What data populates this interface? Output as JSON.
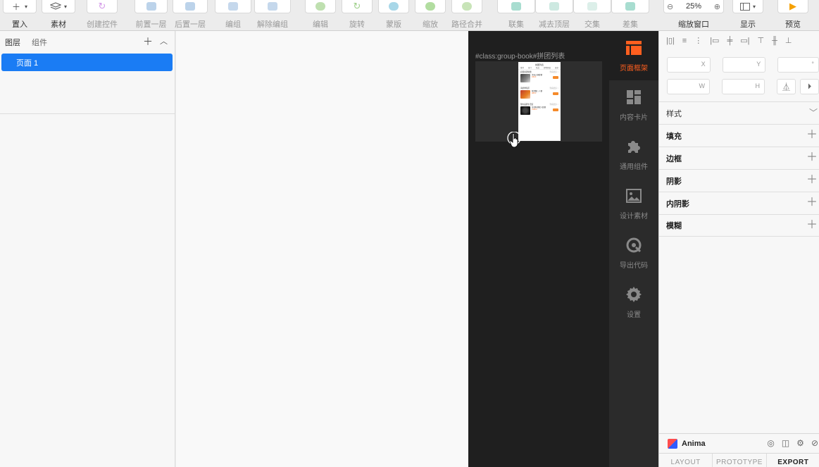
{
  "toolbar": {
    "insert": "置入",
    "assets": "素材",
    "create_symbol": "创建控件",
    "forward": "前置一层",
    "backward": "后置一层",
    "group": "编组",
    "ungroup": "解除编组",
    "edit": "编辑",
    "rotate": "旋转",
    "mask": "蒙版",
    "scale": "缩放",
    "flatten": "路径合并",
    "union": "联集",
    "subtract": "减去顶层",
    "intersect": "交集",
    "difference": "差集",
    "zoom_value": "25%",
    "zoom": "缩放窗口",
    "view": "显示",
    "preview": "预览"
  },
  "left_panel": {
    "tab_layers": "图层",
    "tab_components": "组件",
    "pages": [
      "页面 1"
    ]
  },
  "plugin": {
    "title": "#class:group-book#拼团列表",
    "phone": {
      "title": "拼团列表",
      "tabs": [
        "推荐",
        "热门",
        "新品",
        "即将开始",
        "更多"
      ],
      "sections": [
        {
          "title": "超值拼团特惠",
          "more": "查看更多 >",
          "item": "美味火锅套餐",
          "price": "¥49.9"
        },
        {
          "title": "海鲜季专区",
          "more": "查看更多 >",
          "item": "鲜虾蟹三人餐",
          "price": "¥88.0"
        },
        {
          "title": "限时品质生活馆",
          "more": "查看更多 >",
          "item": "日式料理双人套餐",
          "price": "¥128.0"
        }
      ]
    },
    "nav": [
      {
        "label": "页面框架",
        "icon": "page-frame-icon",
        "active": true
      },
      {
        "label": "内容卡片",
        "icon": "content-card-icon",
        "active": false
      },
      {
        "label": "通用组件",
        "icon": "puzzle-icon",
        "active": false
      },
      {
        "label": "设计素材",
        "icon": "image-icon",
        "active": false
      },
      {
        "label": "导出代码",
        "icon": "export-code-icon",
        "active": false
      },
      {
        "label": "设置",
        "icon": "gear-icon",
        "active": false
      }
    ]
  },
  "inspector": {
    "x": "X",
    "y": "Y",
    "deg": "°",
    "w": "W",
    "h": "H",
    "style": "样式",
    "sections": [
      "填充",
      "边框",
      "阴影",
      "内阴影",
      "模糊"
    ],
    "anima": "Anima",
    "tabs": [
      "LAYOUT",
      "PROTOTYPE",
      "EXPORT"
    ]
  },
  "colors": {
    "accent_blue": "#1a7cf4",
    "accent_orange": "#ff5f1f",
    "panel_dark": "#1f1f1f",
    "nav_dark": "#2b2b2b"
  }
}
